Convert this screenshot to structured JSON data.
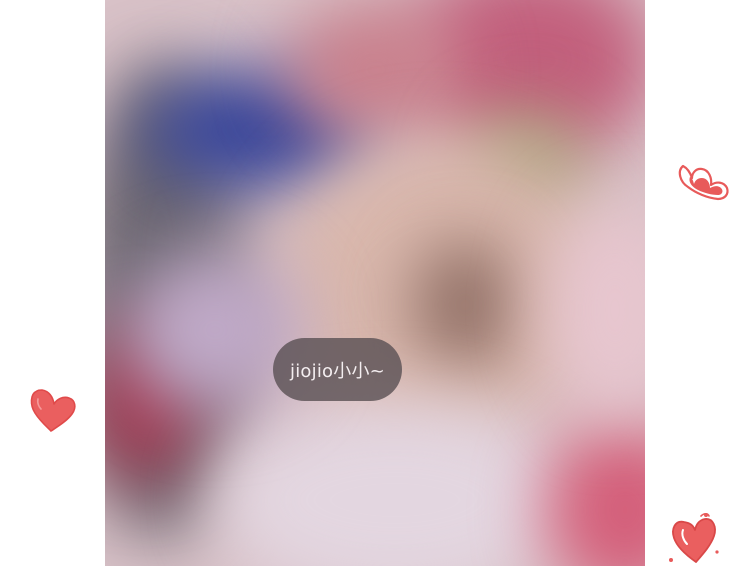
{
  "profile": {
    "nickname": "jiojio小小~"
  },
  "decorations": {
    "icons": [
      "heart-icon",
      "heart-icon",
      "heart-icon"
    ]
  },
  "colors": {
    "heart": "#e85a5a",
    "pill_background": "#5c5256"
  }
}
